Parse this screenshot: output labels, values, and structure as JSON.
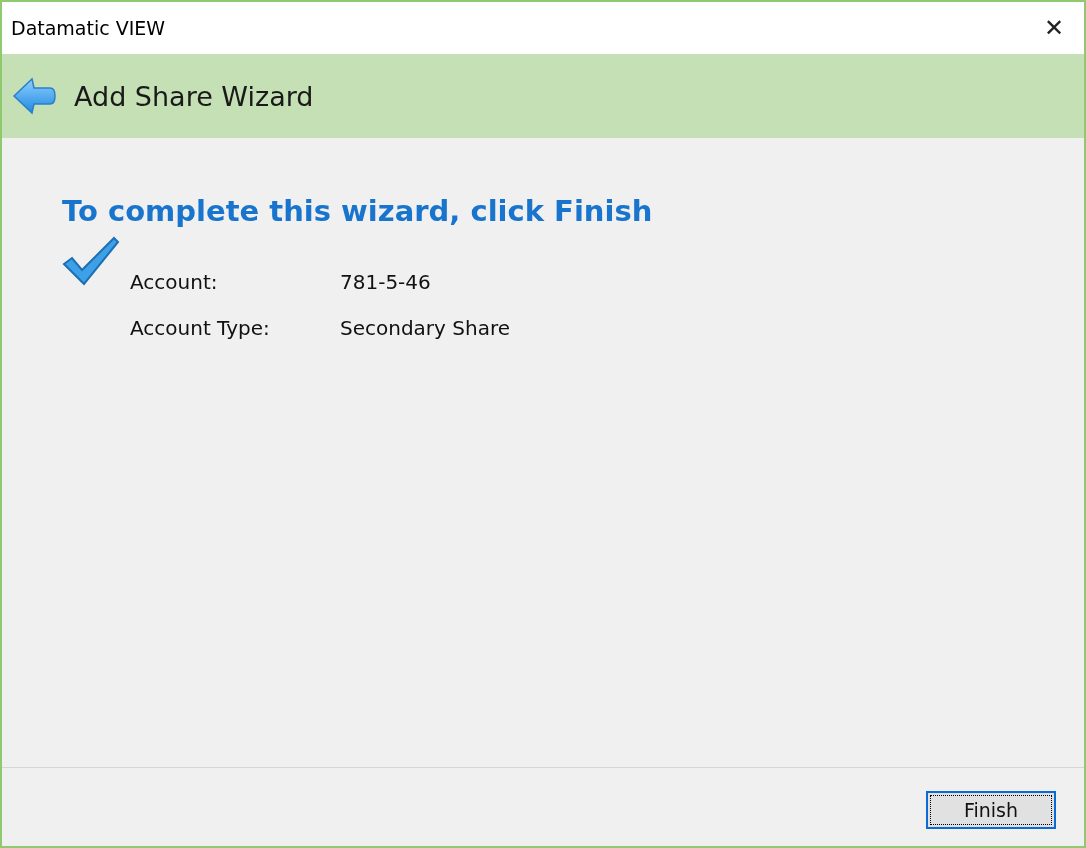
{
  "window": {
    "title": "Datamatic VIEW",
    "close": "✕"
  },
  "header": {
    "title": "Add Share Wizard"
  },
  "heading": "To complete this wizard, click Finish",
  "details": [
    {
      "label": "Account:",
      "value": "781-5-46"
    },
    {
      "label": "Account Type:",
      "value": "Secondary Share"
    }
  ],
  "buttons": [
    {
      "label": "Finish",
      "focused": true
    }
  ]
}
